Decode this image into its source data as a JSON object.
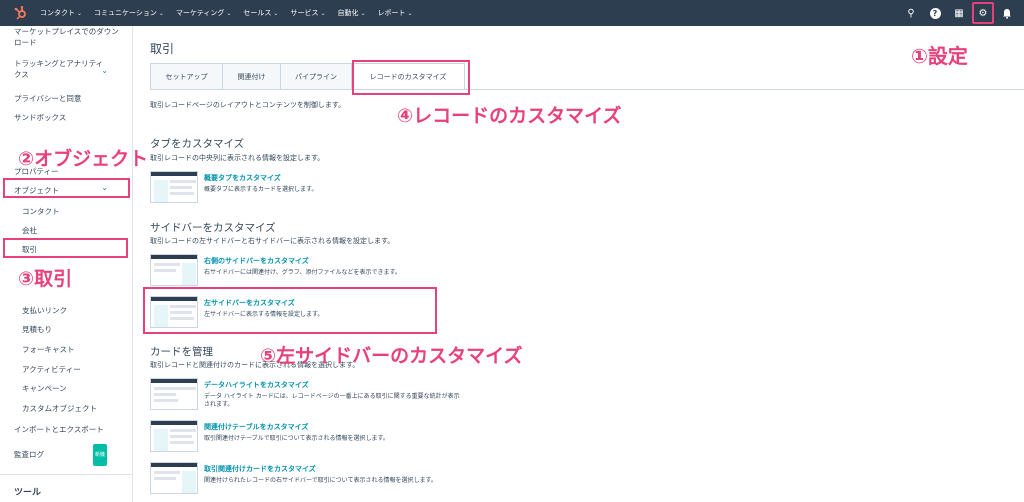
{
  "topnav": {
    "items": [
      "コンタクト",
      "コミュニケーション",
      "マーケティング",
      "セールス",
      "サービス",
      "自動化",
      "レポート"
    ],
    "caret": "⌄",
    "icons": {
      "search": "⚲",
      "help": "?",
      "marketplace": "▦",
      "settings": "⚙",
      "notifications": "🔔"
    }
  },
  "sidebar": {
    "marketplace": "マーケットプレイスでのダウンロード",
    "tracking": "トラッキングとアナリティクス",
    "privacy": "プライバシーと同意",
    "sandbox": "サンドボックス",
    "properties": "プロパティー",
    "objects": "オブジェクト",
    "contacts": "コンタクト",
    "companies": "会社",
    "deals": "取引",
    "payment_links": "支払いリンク",
    "quotes": "見積もり",
    "forecast": "フォーキャスト",
    "activities": "アクティビティー",
    "campaigns": "キャンペーン",
    "custom_objects": "カスタムオブジェクト",
    "import_export": "インポートとエクスポート",
    "audit_log": "監査ログ",
    "new_badge": "新機",
    "tools": "ツール"
  },
  "main": {
    "title": "取引",
    "tabs": [
      "セットアップ",
      "関連付け",
      "パイプライン",
      "レコードのカスタマイズ"
    ],
    "description": "取引レコードページのレイアウトとコンテンツを制御します。",
    "tab_section": {
      "title": "タブをカスタマイズ",
      "desc": "取引レコードの中央列に表示される情報を設定します。",
      "cards": [
        {
          "title": "概要タブをカスタマイズ",
          "desc": "概要タブに表示するカードを選択します。"
        }
      ]
    },
    "sidebar_section": {
      "title": "サイドバーをカスタマイズ",
      "desc": "取引レコードの左サイドバーと右サイドバーに表示される情報を設定します。",
      "cards": [
        {
          "title": "右側のサイドバーをカスタマイズ",
          "desc": "右サイドバーには関連付け、グラフ、添付ファイルなどを表示できます。"
        },
        {
          "title": "左サイドバーをカスタマイズ",
          "desc": "左サイドバーに表示する情報を設定します。"
        }
      ]
    },
    "cards_section": {
      "title": "カードを管理",
      "desc": "取引レコードと関連付けのカードに表示される情報を選択します。",
      "cards": [
        {
          "title": "データハイライトをカスタマイズ",
          "desc": "データ ハイライト カードには、レコードページの一番上にある取引に関する重要な統計が表示されます。"
        },
        {
          "title": "関連付けテーブルをカスタマイズ",
          "desc": "取引関連付けテーブルで取引について表示される情報を選択します。"
        },
        {
          "title": "取引関連付けカードをカスタマイズ",
          "desc": "関連付けられたレコードの右サイドバーで取引について表示される情報を選択します。"
        }
      ]
    }
  },
  "annotations": {
    "settings": "①設定",
    "objects": "②オブジェクト",
    "deals": "③取引",
    "record_customize": "④レコードのカスタマイズ",
    "left_sidebar": "⑤左サイドバーのカスタマイズ"
  },
  "colors": {
    "accent": "#e8407a",
    "nav_bg": "#2d3e50",
    "link": "#0091ae",
    "badge": "#00bda5"
  }
}
